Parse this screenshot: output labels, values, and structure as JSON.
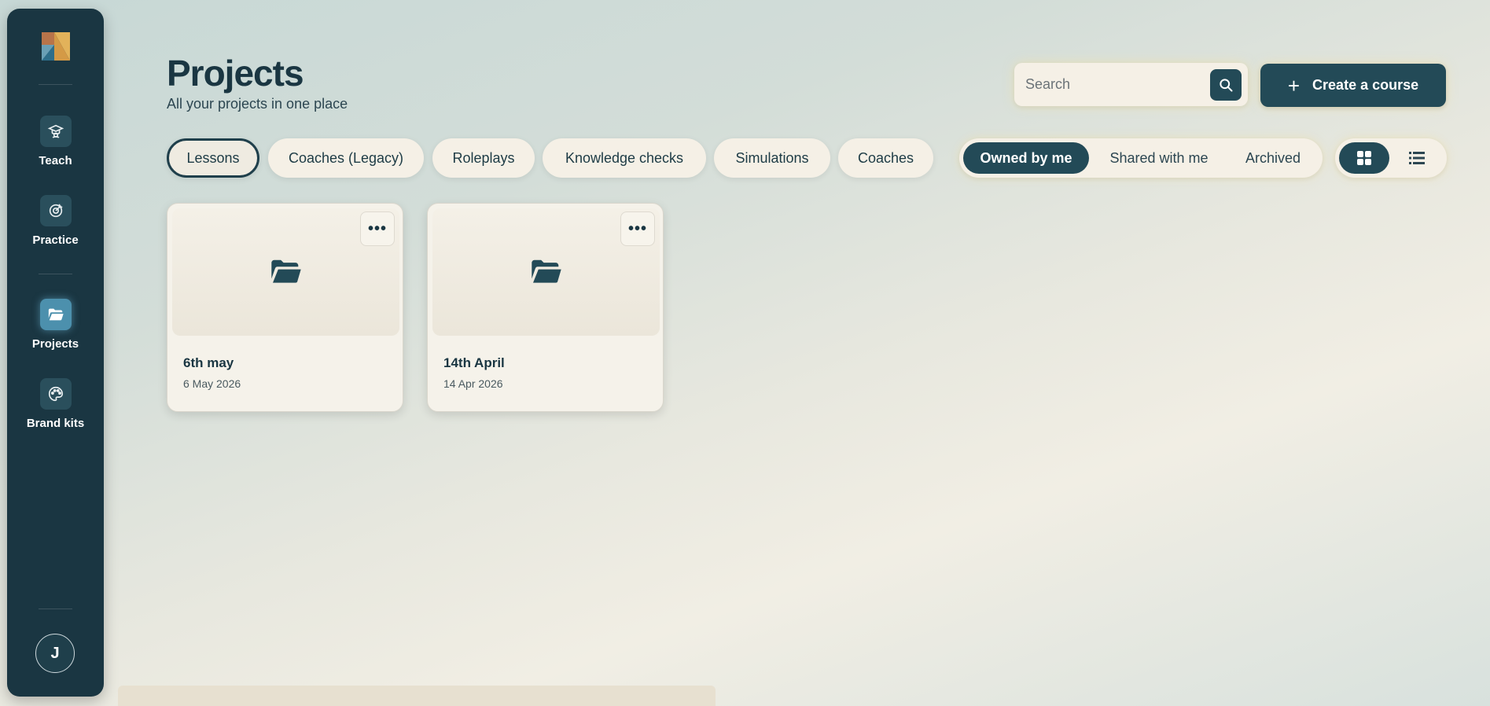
{
  "sidebar": {
    "items": [
      {
        "label": "Teach",
        "icon": "graduation-icon",
        "active": false
      },
      {
        "label": "Practice",
        "icon": "target-icon",
        "active": false
      },
      {
        "label": "Projects",
        "icon": "folder-open-icon",
        "active": true
      },
      {
        "label": "Brand kits",
        "icon": "palette-icon",
        "active": false
      }
    ],
    "avatar_initial": "J"
  },
  "header": {
    "title": "Projects",
    "subtitle": "All your projects in one place"
  },
  "search": {
    "placeholder": "Search",
    "value": ""
  },
  "create_button": {
    "label": "Create a course"
  },
  "type_filters": [
    {
      "label": "Lessons",
      "active": true
    },
    {
      "label": "Coaches (Legacy)",
      "active": false
    },
    {
      "label": "Roleplays",
      "active": false
    },
    {
      "label": "Knowledge checks",
      "active": false
    },
    {
      "label": "Simulations",
      "active": false
    },
    {
      "label": "Coaches",
      "active": false
    }
  ],
  "ownership_filters": [
    {
      "label": "Owned by me",
      "active": true
    },
    {
      "label": "Shared with me",
      "active": false
    },
    {
      "label": "Archived",
      "active": false
    }
  ],
  "view_toggle": {
    "selected": "grid",
    "options": [
      "grid-icon",
      "list-icon"
    ]
  },
  "projects": [
    {
      "name": "6th may",
      "date": "6 May 2026",
      "menu": "•••"
    },
    {
      "name": "14th April",
      "date": "14 Apr 2026",
      "menu": "•••"
    }
  ],
  "colors": {
    "primary": "#234a57",
    "sidebar": "#1a3642",
    "surface": "#f5f0e6",
    "active_nav": "#4c90ad"
  }
}
